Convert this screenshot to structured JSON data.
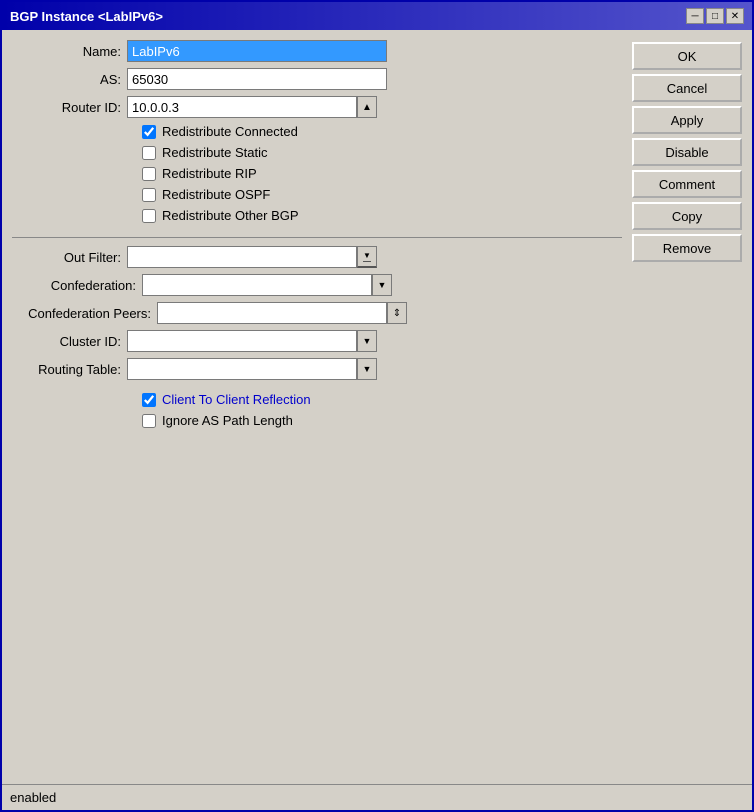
{
  "window": {
    "title": "BGP Instance <LabIPv6>",
    "minimize_label": "─",
    "restore_label": "□",
    "close_label": "✕"
  },
  "form": {
    "name_label": "Name:",
    "name_value": "LabIPv6",
    "as_label": "AS:",
    "as_value": "65030",
    "router_id_label": "Router ID:",
    "router_id_value": "10.0.0.3",
    "checkboxes": [
      {
        "label": "Redistribute Connected",
        "checked": true
      },
      {
        "label": "Redistribute Static",
        "checked": false
      },
      {
        "label": "Redistribute RIP",
        "checked": false
      },
      {
        "label": "Redistribute OSPF",
        "checked": false
      },
      {
        "label": "Redistribute Other BGP",
        "checked": false
      }
    ],
    "out_filter_label": "Out Filter:",
    "out_filter_value": "",
    "confederation_label": "Confederation:",
    "confederation_value": "",
    "confederation_peers_label": "Confederation Peers:",
    "confederation_peers_value": "",
    "cluster_id_label": "Cluster ID:",
    "cluster_id_value": "",
    "routing_table_label": "Routing Table:",
    "routing_table_value": "",
    "checkboxes2": [
      {
        "label": "Client To Client Reflection",
        "checked": true
      },
      {
        "label": "Ignore AS Path Length",
        "checked": false
      }
    ]
  },
  "buttons": {
    "ok": "OK",
    "cancel": "Cancel",
    "apply": "Apply",
    "disable": "Disable",
    "comment": "Comment",
    "copy": "Copy",
    "remove": "Remove"
  },
  "status": {
    "text": "enabled"
  },
  "icons": {
    "up_arrow": "▲",
    "down_arrow": "▼",
    "spin_arrow": "⬆",
    "dropdown_down": "▼",
    "dropdown_filter": "▼",
    "spin_both": "⇕"
  }
}
